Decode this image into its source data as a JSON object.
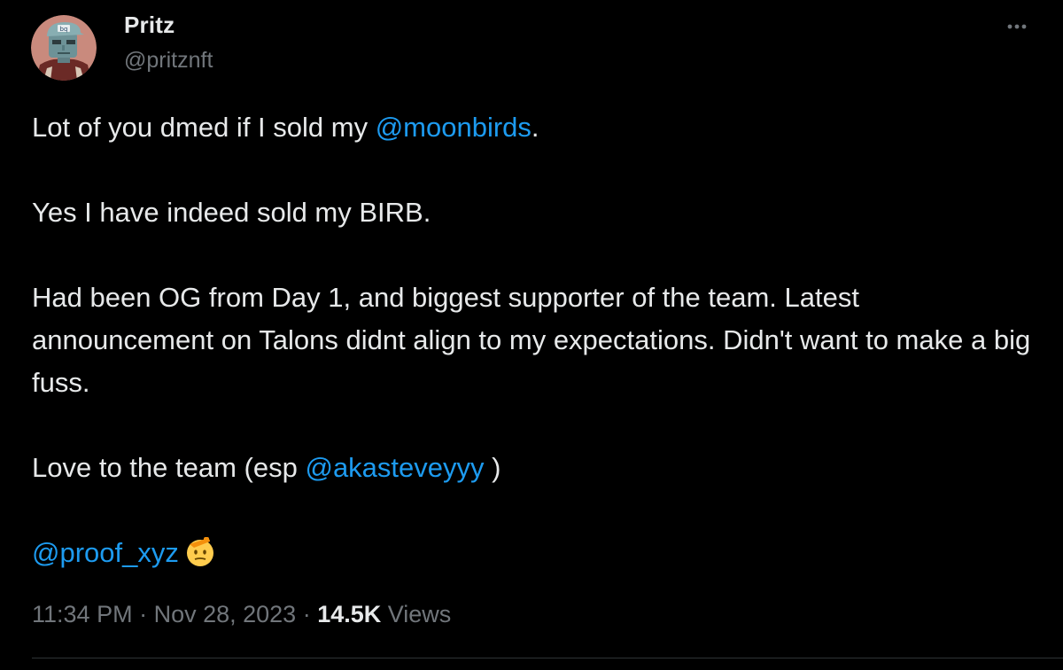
{
  "author": {
    "display_name": "Pritz",
    "handle": "@pritznft",
    "avatar_icon": "avatar-nft-image"
  },
  "more_icon": "more-horizontal-icon",
  "tweet": {
    "line1_prefix": "Lot of you dmed if I sold my ",
    "mention_moonbirds": "@moonbirds",
    "line1_suffix": ".",
    "line2": "Yes I have indeed sold my BIRB.",
    "line3": "Had been OG from Day 1, and biggest supporter of the team. Latest announcement on Talons didnt align to my expectations. Didn't want to make a big fuss.",
    "line4_prefix": "Love to the team (esp ",
    "mention_akasteve": "@akasteveyyy",
    "line4_suffix": " )",
    "mention_proof": "@proof_xyz",
    "emoji": "saluting-face-emoji"
  },
  "meta": {
    "time": "11:34 PM",
    "separator": " · ",
    "date": "Nov 28, 2023",
    "views_count": "14.5K",
    "views_label": " Views"
  },
  "colors": {
    "background": "#000000",
    "text_primary": "#e7e9ea",
    "text_secondary": "#71767b",
    "link": "#1d9bf0",
    "divider": "#2f3336"
  }
}
